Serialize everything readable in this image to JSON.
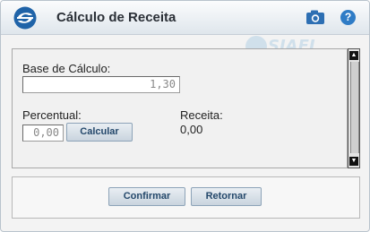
{
  "window": {
    "title": "Cálculo de Receita"
  },
  "header": {
    "logo_icon": "siafi-logo-icon",
    "camera_icon": "camera-icon",
    "help_label": "?"
  },
  "form": {
    "base_label": "Base de Cálculo:",
    "base_value": "1,30",
    "percentual_label": "Percentual:",
    "percentual_value": "0,00",
    "calcular_label": "Calcular",
    "receita_label": "Receita:",
    "receita_value": "0,00"
  },
  "footer": {
    "confirmar_label": "Confirmar",
    "retornar_label": "Retornar"
  },
  "watermark": {
    "text": "SIAFI"
  },
  "colors": {
    "accent": "#2f7cc6",
    "button_text": "#24486b"
  }
}
